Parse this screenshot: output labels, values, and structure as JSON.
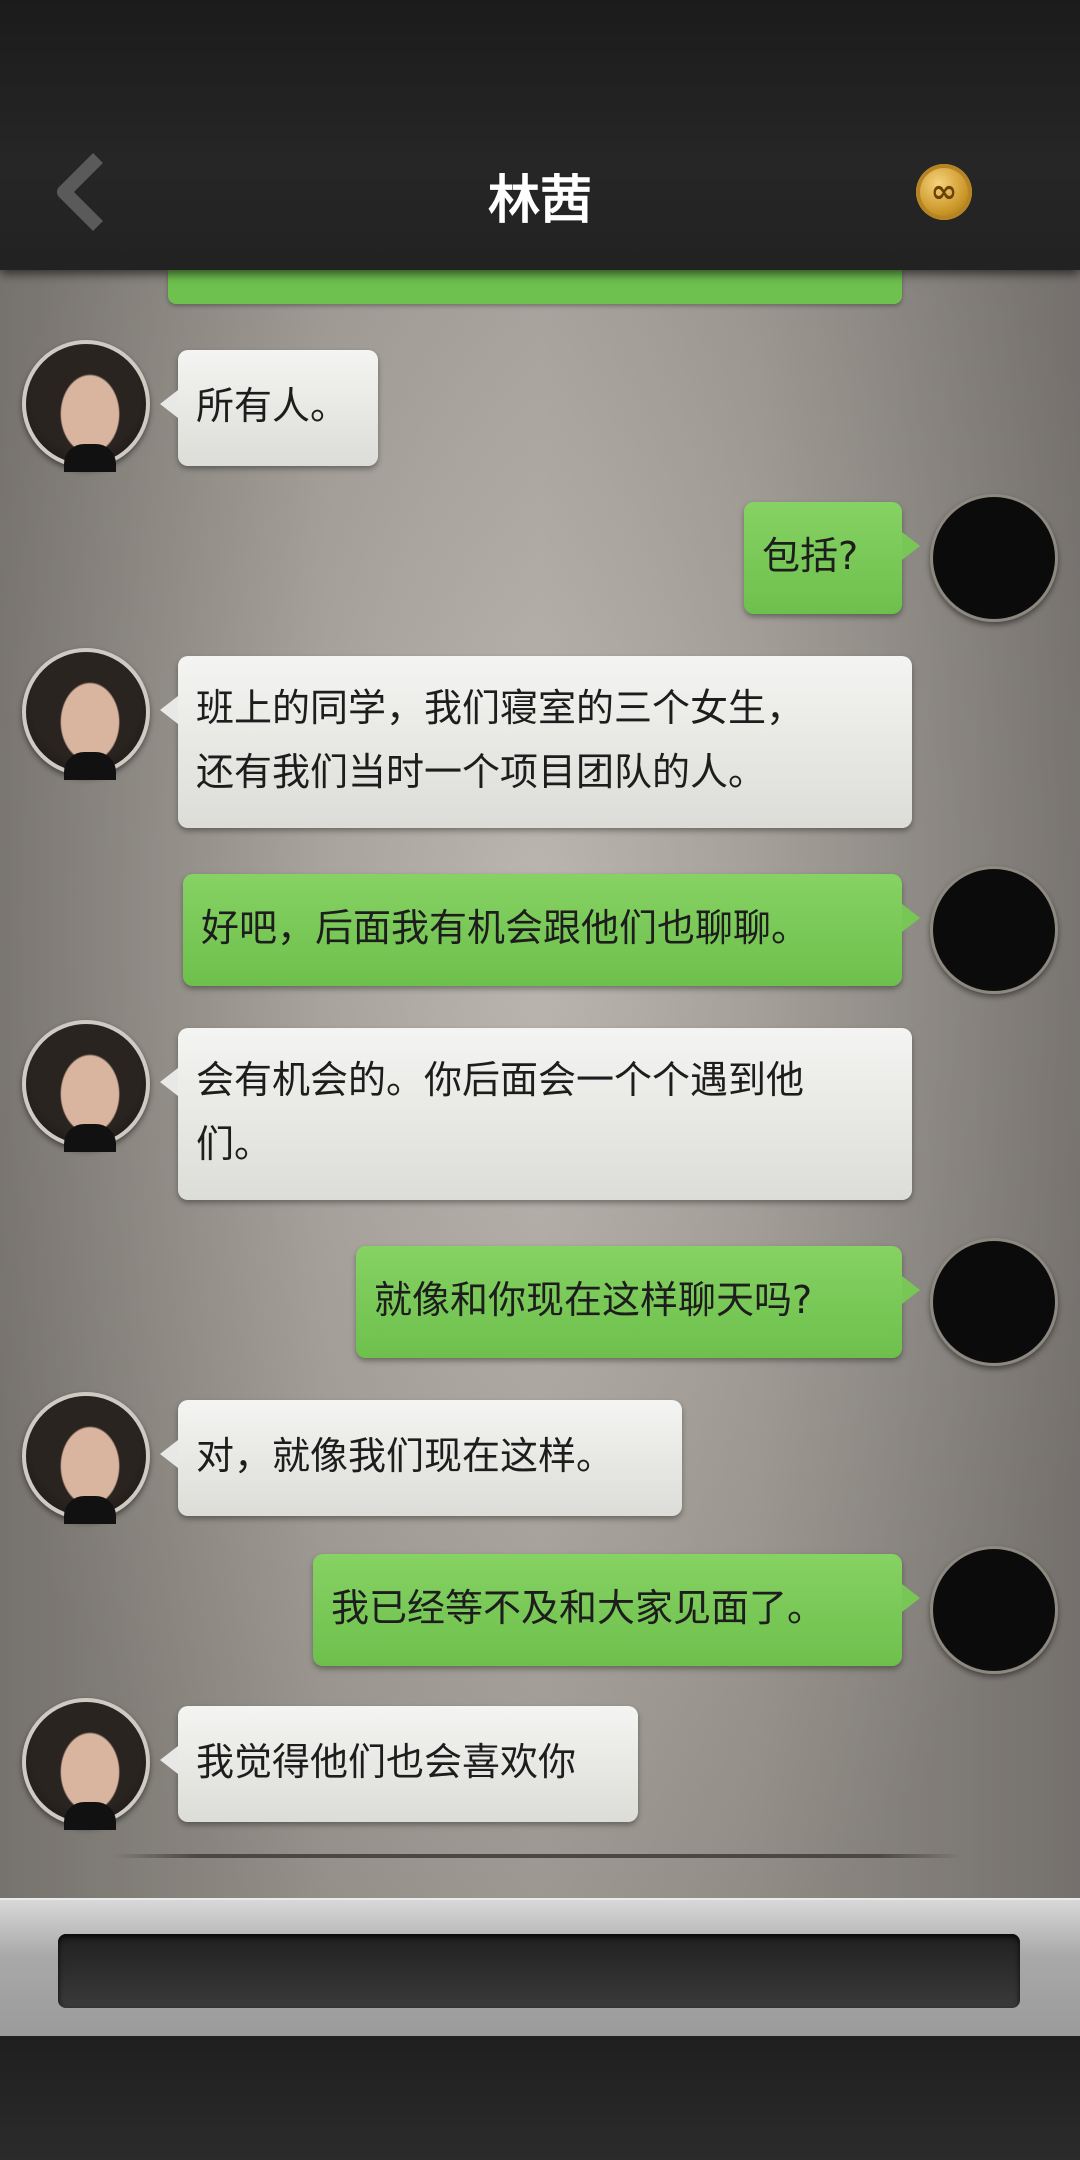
{
  "header": {
    "title": "林茜",
    "back_icon": "chevron-left-icon",
    "menu_icon": "infinity-coin-icon",
    "menu_glyph": "∞"
  },
  "messages": [
    {
      "side": "left",
      "text": "所有人。"
    },
    {
      "side": "right",
      "text": "包括?"
    },
    {
      "side": "left",
      "lines": [
        "班上的同学，我们寝室的三个女生，",
        "还有我们当时一个项目团队的人。"
      ]
    },
    {
      "side": "right",
      "text": "好吧，后面我有机会跟他们也聊聊。"
    },
    {
      "side": "left",
      "lines": [
        "会有机会的。你后面会一个个遇到他",
        "们。"
      ]
    },
    {
      "side": "right",
      "text": "就像和你现在这样聊天吗?"
    },
    {
      "side": "left",
      "text": "对，就像我们现在这样。"
    },
    {
      "side": "right",
      "text": "我已经等不及和大家见面了。"
    },
    {
      "side": "left",
      "text": "我觉得他们也会喜欢你"
    }
  ],
  "input": {
    "value": ""
  },
  "colors": {
    "accent_green": "#6fc14f",
    "header_bg": "#1e1e1e"
  }
}
